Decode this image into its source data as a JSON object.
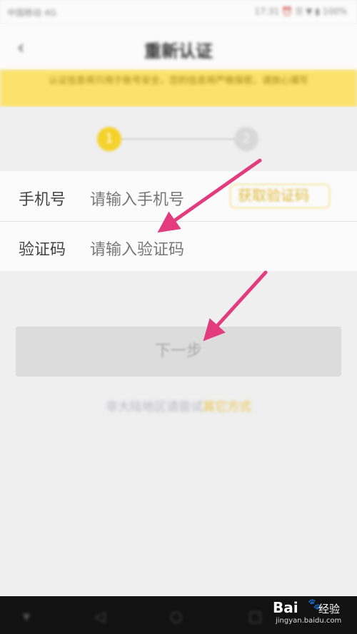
{
  "status_bar": {
    "left": "中国移动 4G",
    "right": "17:31 ⏰ ☰ ▼ ▮ 100%"
  },
  "nav": {
    "back": "‹",
    "title": "重新认证"
  },
  "notice": {
    "text": "认证信息将只用于账号安全，您的信息将严格保密，请放心填写"
  },
  "steps": {
    "step1": "1",
    "step2": "2"
  },
  "form": {
    "phone_label": "手机号",
    "phone_placeholder": "请输入手机号",
    "get_code": "获取验证码",
    "code_label": "验证码",
    "code_placeholder": "请输入验证码"
  },
  "next_button": "下一步",
  "region": {
    "text": "非大陆地区请尝试",
    "link": "其它方式"
  },
  "bottom_nav": {
    "b1": "▾",
    "b2": "◁",
    "b3": "○",
    "b4": "□"
  },
  "watermark": {
    "brand": "Bai",
    "paw": "🐾",
    "brand2": "经验",
    "url": "jingyan.baidu.com"
  },
  "colors": {
    "accent": "#f5d22b",
    "arrow": "#e23b7e"
  }
}
